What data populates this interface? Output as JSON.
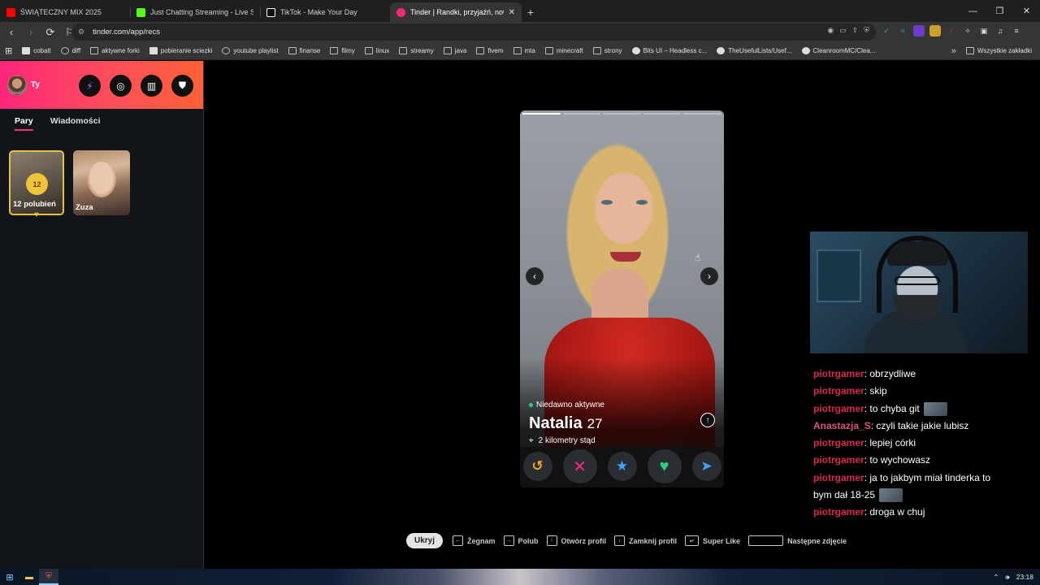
{
  "tabs": [
    {
      "title": "ŚWIĄTECZNY MIX 2025",
      "favicon_color": "#ff0000",
      "active": false
    },
    {
      "title": "Just Chatting Streaming - Live Stream",
      "favicon_color": "#53fc18",
      "active": false
    },
    {
      "title": "TikTok - Make Your Day",
      "favicon_color": "#ffffff",
      "active": false
    },
    {
      "title": "Tinder | Randki, przyjaźń, nowe zn",
      "favicon_color": "#fd267a",
      "active": true
    }
  ],
  "address": {
    "url": "tinder.com/app/recs"
  },
  "bookmarks": [
    "cobalt",
    "diff",
    "aktywne forki",
    "pobieranie sciezki",
    "youtube playlist",
    "finanse",
    "filmy",
    "linux",
    "streamy",
    "java",
    "fivem",
    "mta",
    "minecraft",
    "strony",
    "Bits UI – Headless c...",
    "TheUsefulLists/Usef...",
    "CleanroomMC/Clea..."
  ],
  "bookmarks_all": "Wszystkie zakładki",
  "sidebar": {
    "user_name": "Ty",
    "tabs": [
      {
        "label": "Pary",
        "active": true
      },
      {
        "label": "Wiadomości",
        "active": false
      }
    ],
    "likes": {
      "count": "12",
      "label": "12 polubień"
    },
    "matches": [
      {
        "name": "Zuza"
      }
    ]
  },
  "profile": {
    "status": "Niedawno aktywne",
    "name": "Natalia",
    "age": "27",
    "distance": "2 kilometry stąd",
    "photo_count": 5,
    "current_photo": 1
  },
  "chat": [
    {
      "user": "piotrgamer",
      "text": "obrzydliwe",
      "emote": false
    },
    {
      "user": "piotrgamer",
      "text": "skip",
      "emote": false
    },
    {
      "user": "piotrgamer",
      "text": "to chyba git",
      "emote": true
    },
    {
      "user": "Anastazja_S",
      "text": "czyli takie jakie lubisz",
      "emote": false
    },
    {
      "user": "piotrgamer",
      "text": "lepiej córki",
      "emote": false
    },
    {
      "user": "piotrgamer",
      "text": "to wychowasz",
      "emote": false
    },
    {
      "user": "piotrgamer",
      "text": "ja to jakbym miał tinderka to",
      "emote": false
    },
    {
      "user": "",
      "text": "bym dał 18-25",
      "emote": true
    },
    {
      "user": "piotrgamer",
      "text": "droga w chuj",
      "emote": false
    }
  ],
  "hints": {
    "hide": "Ukryj",
    "nope": "Żegnam",
    "like": "Polub",
    "open": "Otwórz profil",
    "close": "Zamknij profil",
    "superlike": "Super Like",
    "next": "Następne zdjęcie"
  },
  "taskbar": {
    "time": "23:18"
  },
  "colors": {
    "brand": "#fd267a",
    "accent_orange": "#ff6036",
    "like": "#26d07c",
    "superlike": "#3ca4ff",
    "gold": "#efc43a"
  }
}
